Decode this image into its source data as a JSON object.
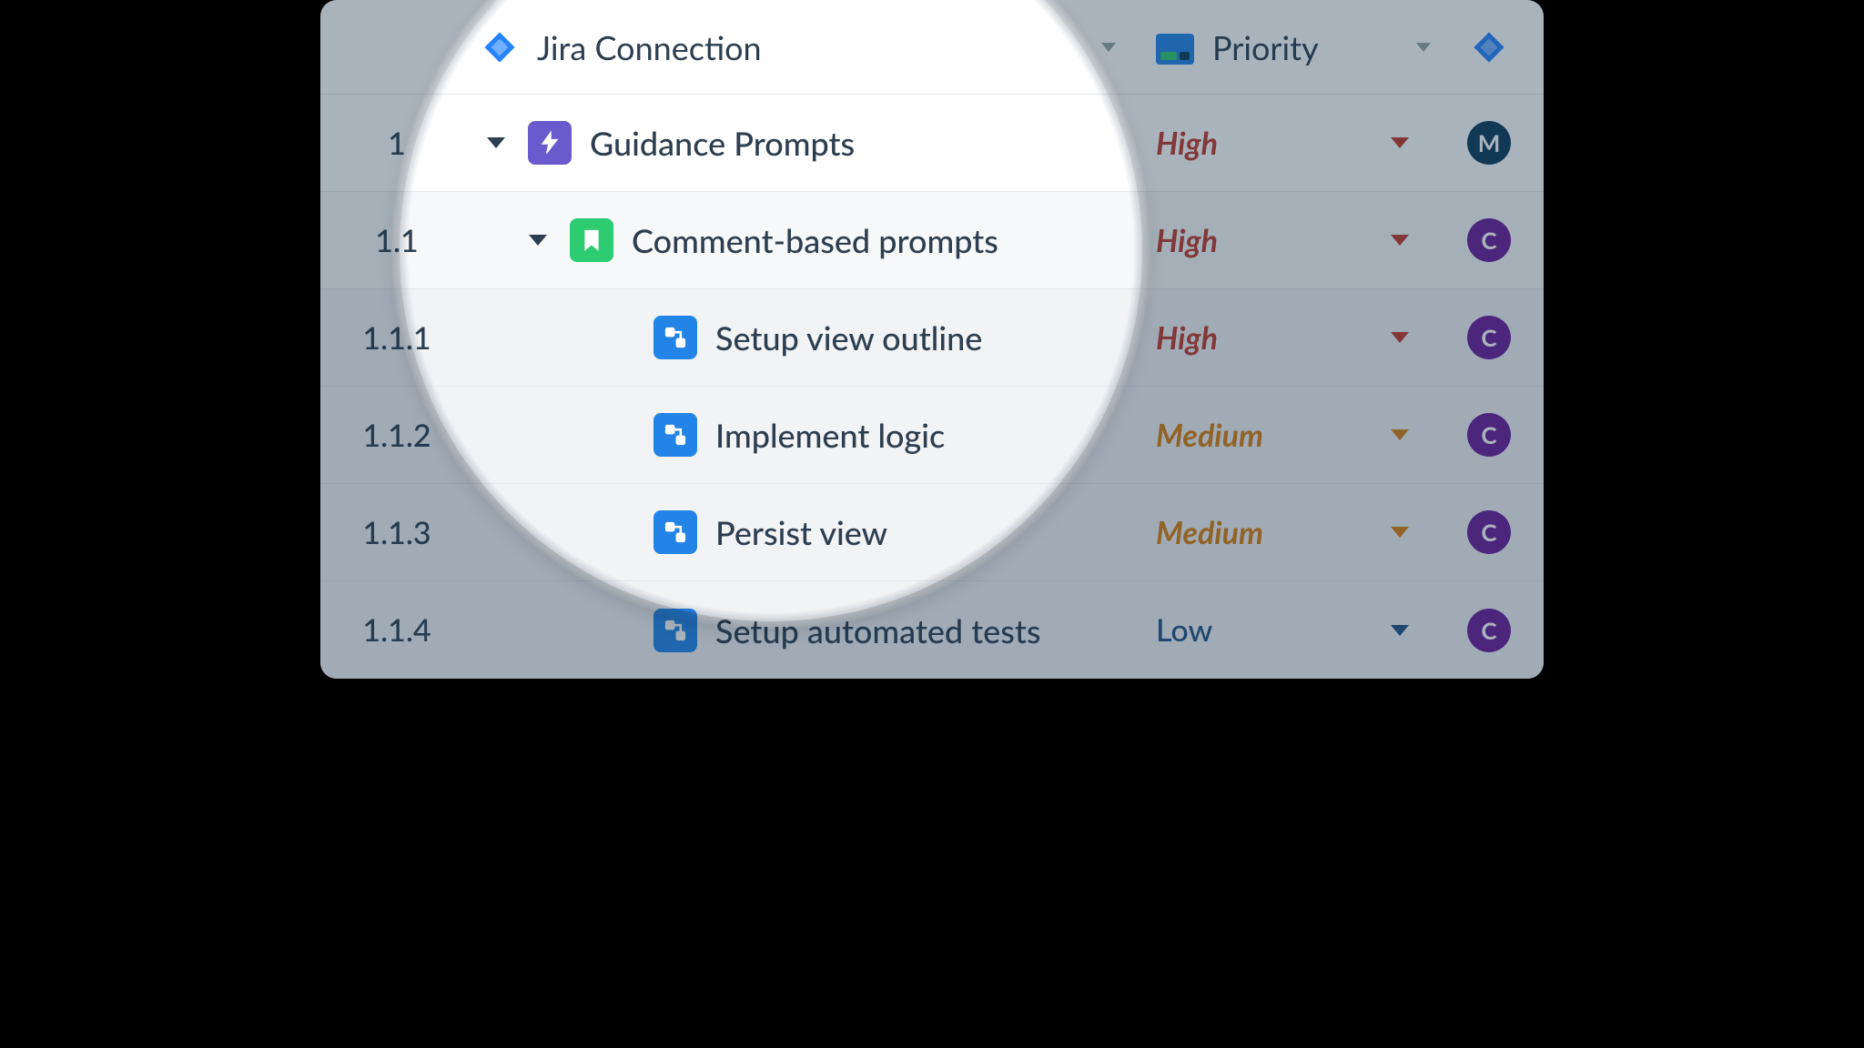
{
  "header": {
    "name_column": "Jira Connection",
    "priority_column": "Priority"
  },
  "rows": [
    {
      "num": "1",
      "title": "Guidance Prompts",
      "type": "epic",
      "indent": 0,
      "expandable": true,
      "priority": "High",
      "prio_class": "high",
      "avatar": "M",
      "avatar_class": "m",
      "shade": 0
    },
    {
      "num": "1.1",
      "title": "Comment-based prompts",
      "type": "story",
      "indent": 1,
      "expandable": true,
      "priority": "High",
      "prio_class": "high",
      "avatar": "C",
      "avatar_class": "c",
      "shade": 1
    },
    {
      "num": "1.1.1",
      "title": "Setup view outline",
      "type": "task",
      "indent": 2,
      "expandable": false,
      "priority": "High",
      "prio_class": "high",
      "avatar": "C",
      "avatar_class": "c",
      "shade": 2
    },
    {
      "num": "1.1.2",
      "title": "Implement logic",
      "type": "task",
      "indent": 2,
      "expandable": false,
      "priority": "Medium",
      "prio_class": "med",
      "avatar": "C",
      "avatar_class": "c",
      "shade": 2
    },
    {
      "num": "1.1.3",
      "title": "Persist view",
      "type": "task",
      "indent": 2,
      "expandable": false,
      "priority": "Medium",
      "prio_class": "med",
      "avatar": "C",
      "avatar_class": "c",
      "shade": 2
    },
    {
      "num": "1.1.4",
      "title": "Setup automated tests",
      "type": "task",
      "indent": 2,
      "expandable": false,
      "priority": "Low",
      "prio_class": "low",
      "avatar": "C",
      "avatar_class": "c",
      "shade": 2
    }
  ]
}
